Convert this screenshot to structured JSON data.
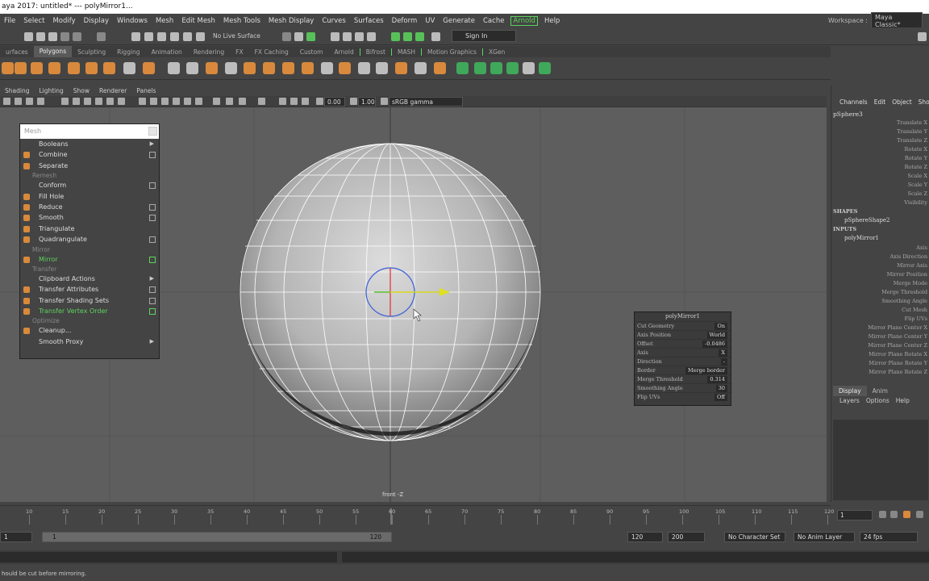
{
  "window": {
    "title": "aya 2017: untitled*   ---   polyMirror1..."
  },
  "menubar": {
    "items": [
      "File",
      "Select",
      "Modify",
      "Display",
      "Windows",
      "Mesh",
      "Edit Mesh",
      "Mesh Tools",
      "Mesh Display",
      "Curves",
      "Surfaces",
      "Deform",
      "UV",
      "Generate",
      "Cache"
    ],
    "arnold": "Arnold",
    "help": "Help"
  },
  "workspace": {
    "label": "Workspace :",
    "value": "Maya Classic*"
  },
  "statusline": {
    "live_surface": "No Live Surface",
    "sign_in": "Sign In"
  },
  "shelf_tabs": [
    "urfaces",
    "Polygons",
    "Sculpting",
    "Rigging",
    "Animation",
    "Rendering",
    "FX",
    "FX Caching",
    "Custom",
    "Arnold",
    "Bifrost",
    "MASH",
    "Motion Graphics",
    "XGen"
  ],
  "panel_menu": [
    "Shading",
    "Lighting",
    "Show",
    "Renderer",
    "Panels"
  ],
  "panel_toolbar": {
    "value1": "0.00",
    "value2": "1.00",
    "colorspace": "sRGB gamma"
  },
  "viewport": {
    "camera_label": "front -Z"
  },
  "mesh_menu": {
    "title": "Mesh",
    "items": [
      {
        "label": "Booleans",
        "type": "submenu"
      },
      {
        "label": "Combine",
        "type": "option"
      },
      {
        "label": "Separate",
        "type": "plain"
      },
      {
        "section": "Remesh"
      },
      {
        "label": "Conform",
        "type": "option"
      },
      {
        "label": "Fill Hole",
        "type": "plain"
      },
      {
        "label": "Reduce",
        "type": "option"
      },
      {
        "label": "Smooth",
        "type": "option"
      },
      {
        "label": "Triangulate",
        "type": "plain"
      },
      {
        "label": "Quadrangulate",
        "type": "option"
      },
      {
        "section": "Mirror"
      },
      {
        "label": "Mirror",
        "type": "option",
        "highlight": true
      },
      {
        "section": "Transfer"
      },
      {
        "label": "Clipboard Actions",
        "type": "submenu"
      },
      {
        "label": "Transfer Attributes",
        "type": "option"
      },
      {
        "label": "Transfer Shading Sets",
        "type": "option"
      },
      {
        "label": "Transfer Vertex Order",
        "type": "option",
        "highlight": true
      },
      {
        "section": "Optimize"
      },
      {
        "label": "Cleanup...",
        "type": "plain"
      },
      {
        "label": "Smooth Proxy",
        "type": "submenu"
      }
    ]
  },
  "poly_mirror": {
    "title": "polyMirror1",
    "rows": [
      {
        "label": "Cut Geometry",
        "value": "On"
      },
      {
        "label": "Axis Position",
        "value": "World"
      },
      {
        "label": "Offset",
        "value": "-0.0486"
      },
      {
        "label": "Axis",
        "value": "X"
      },
      {
        "label": "Direction",
        "value": "-"
      },
      {
        "label": "Border",
        "value": "Merge border"
      },
      {
        "label": "Merge Threshold",
        "value": "0.314"
      },
      {
        "label": "Smoothing Angle",
        "value": "30"
      },
      {
        "label": "Flip UVs",
        "value": "Off"
      }
    ]
  },
  "channel_box": {
    "tabs": [
      "Channels",
      "Edit",
      "Object",
      "Show"
    ],
    "object": "pSphere3",
    "attributes": [
      "Translate X",
      "Translate Y",
      "Translate Z",
      "Rotate X",
      "Rotate Y",
      "Rotate Z",
      "Scale X",
      "Scale Y",
      "Scale Z",
      "Visibility"
    ],
    "shapes_header": "SHAPES",
    "shape": "pSphereShape2",
    "inputs_header": "INPUTS",
    "input": "polyMirror1",
    "input_attributes": [
      "Axis",
      "Axis Direction",
      "Mirror Axis",
      "Mirror Position",
      "Merge Mode",
      "Merge Threshold",
      "Smoothing Angle",
      "Cut Mesh",
      "Flip UVs",
      "Mirror Plane Center X",
      "Mirror Plane Center Y",
      "Mirror Plane Center Z",
      "Mirror Plane Rotate X",
      "Mirror Plane Rotate Y",
      "Mirror Plane Rotate Z"
    ],
    "display_tabs": [
      "Display",
      "Anim"
    ],
    "display_menu": [
      "Layers",
      "Options",
      "Help"
    ]
  },
  "timeline": {
    "ticks": [
      "10",
      "15",
      "20",
      "25",
      "30",
      "35",
      "40",
      "45",
      "50",
      "55",
      "60",
      "65",
      "70",
      "75",
      "80",
      "85",
      "90",
      "95",
      "100",
      "105",
      "110",
      "115",
      "120"
    ],
    "current_frame": "1"
  },
  "range": {
    "start": "1",
    "slider_start": "1",
    "slider_end": "120",
    "end1": "120",
    "end2": "200",
    "character_set": "No Character Set",
    "anim_layer": "No Anim Layer",
    "fps": "24 fps"
  },
  "help_line": "hould be cut before mirroring."
}
